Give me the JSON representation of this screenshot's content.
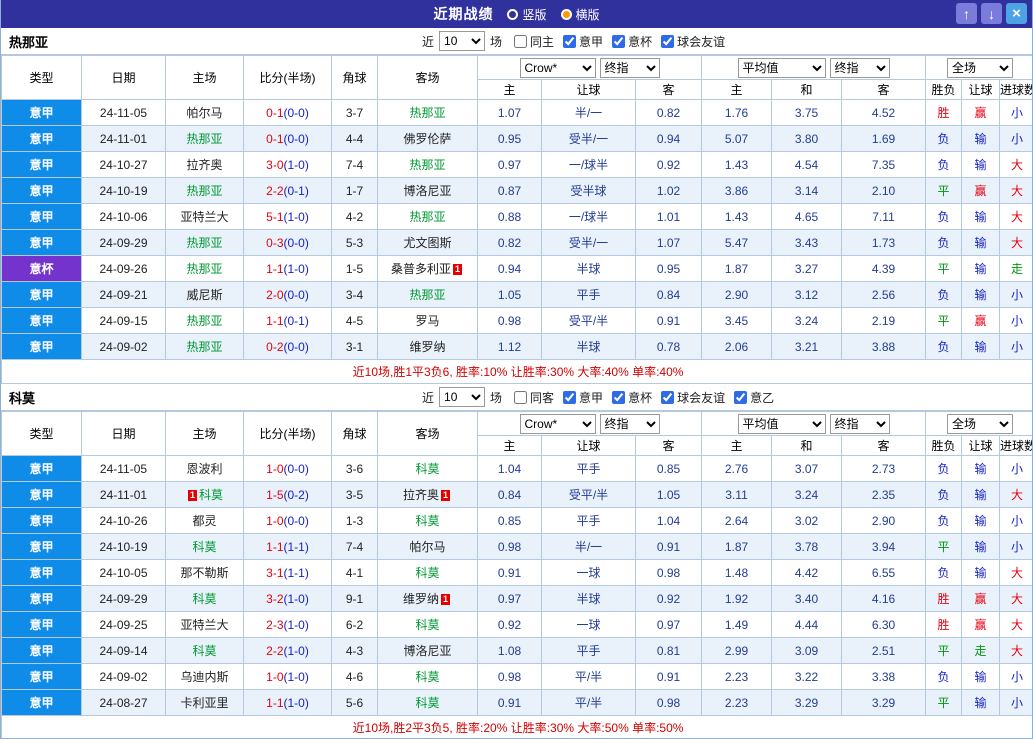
{
  "titlebar": {
    "title": "近期战绩",
    "radios": [
      {
        "label": "竖版",
        "selected": false
      },
      {
        "label": "横版",
        "selected": true
      }
    ],
    "up_glyph": "↑",
    "down_glyph": "↓",
    "close_glyph": "×"
  },
  "table_header": {
    "left_cols": [
      "类型",
      "日期",
      "主场",
      "比分(半场)",
      "角球",
      "客场"
    ],
    "group1": {
      "select1": "Crow*",
      "select2": "终指",
      "subcols": [
        "主",
        "让球",
        "客"
      ]
    },
    "group2": {
      "select1": "平均值",
      "select2": "终指",
      "subcols": [
        "主",
        "和",
        "客"
      ]
    },
    "group3": {
      "select1": "全场",
      "subcols": [
        "胜负",
        "让球",
        "进球数"
      ]
    }
  },
  "colors": {
    "titlebar_bg": "#31319e",
    "radio_selected": "#ff9900",
    "league": {
      "意甲": "#0f8ce8",
      "意杯": "#7433cc"
    },
    "results": {
      "胜": "#e60012",
      "赢": "#e60012",
      "大": "#e60012",
      "平": "#00930f",
      "走": "#00930f",
      "负": "#1522c8",
      "输": "#1522c8",
      "小": "#1522c8"
    },
    "score_full": "#e60012",
    "score_half": "#1522c8",
    "focus_team": "#009933",
    "odds_text": "#233c92",
    "summary_text": "#d40000"
  },
  "sections": [
    {
      "team": "热那亚",
      "filter": {
        "near_label": "近",
        "count": "10",
        "games_label": "场",
        "checkboxes": [
          {
            "label": "同主",
            "checked": false
          },
          {
            "label": "意甲",
            "checked": true
          },
          {
            "label": "意杯",
            "checked": true
          },
          {
            "label": "球会友谊",
            "checked": true
          }
        ]
      },
      "rows": [
        {
          "league": "意甲",
          "date": "24-11-05",
          "home": "帕尔马",
          "score": "0-1",
          "half": "(0-0)",
          "corner": "3-7",
          "away": "热那亚",
          "away_focus": true,
          "crow_home": "1.07",
          "crow_line": "半/一",
          "crow_away": "0.82",
          "avg_home": "1.76",
          "avg_draw": "3.75",
          "avg_away": "4.52",
          "wdl": "胜",
          "let_result": "赢",
          "goal_result": "小"
        },
        {
          "league": "意甲",
          "date": "24-11-01",
          "home": "热那亚",
          "home_focus": true,
          "score": "0-1",
          "half": "(0-0)",
          "corner": "4-4",
          "away": "佛罗伦萨",
          "crow_home": "0.95",
          "crow_line": "受半/一",
          "crow_away": "0.94",
          "avg_home": "5.07",
          "avg_draw": "3.80",
          "avg_away": "1.69",
          "wdl": "负",
          "let_result": "输",
          "goal_result": "小"
        },
        {
          "league": "意甲",
          "date": "24-10-27",
          "home": "拉齐奥",
          "score": "3-0",
          "half": "(1-0)",
          "corner": "7-4",
          "away": "热那亚",
          "away_focus": true,
          "crow_home": "0.97",
          "crow_line": "一/球半",
          "crow_away": "0.92",
          "avg_home": "1.43",
          "avg_draw": "4.54",
          "avg_away": "7.35",
          "wdl": "负",
          "let_result": "输",
          "goal_result": "大"
        },
        {
          "league": "意甲",
          "date": "24-10-19",
          "home": "热那亚",
          "home_focus": true,
          "score": "2-2",
          "half": "(0-1)",
          "corner": "1-7",
          "away": "博洛尼亚",
          "crow_home": "0.87",
          "crow_line": "受半球",
          "crow_away": "1.02",
          "avg_home": "3.86",
          "avg_draw": "3.14",
          "avg_away": "2.10",
          "wdl": "平",
          "let_result": "赢",
          "goal_result": "大"
        },
        {
          "league": "意甲",
          "date": "24-10-06",
          "home": "亚特兰大",
          "score": "5-1",
          "half": "(1-0)",
          "corner": "4-2",
          "away": "热那亚",
          "away_focus": true,
          "crow_home": "0.88",
          "crow_line": "一/球半",
          "crow_away": "1.01",
          "avg_home": "1.43",
          "avg_draw": "4.65",
          "avg_away": "7.11",
          "wdl": "负",
          "let_result": "输",
          "goal_result": "大"
        },
        {
          "league": "意甲",
          "date": "24-09-29",
          "home": "热那亚",
          "home_focus": true,
          "score": "0-3",
          "half": "(0-0)",
          "corner": "5-3",
          "away": "尤文图斯",
          "crow_home": "0.82",
          "crow_line": "受半/一",
          "crow_away": "1.07",
          "avg_home": "5.47",
          "avg_draw": "3.43",
          "avg_away": "1.73",
          "wdl": "负",
          "let_result": "输",
          "goal_result": "大"
        },
        {
          "league": "意杯",
          "date": "24-09-26",
          "home": "热那亚",
          "home_focus": true,
          "score": "1-1",
          "half": "(1-0)",
          "corner": "1-5",
          "away": "桑普多利亚",
          "away_card": "1",
          "crow_home": "0.94",
          "crow_line": "半球",
          "crow_away": "0.95",
          "avg_home": "1.87",
          "avg_draw": "3.27",
          "avg_away": "4.39",
          "wdl": "平",
          "let_result": "输",
          "goal_result": "走"
        },
        {
          "league": "意甲",
          "date": "24-09-21",
          "home": "威尼斯",
          "score": "2-0",
          "half": "(0-0)",
          "corner": "3-4",
          "away": "热那亚",
          "away_focus": true,
          "crow_home": "1.05",
          "crow_line": "平手",
          "crow_away": "0.84",
          "avg_home": "2.90",
          "avg_draw": "3.12",
          "avg_away": "2.56",
          "wdl": "负",
          "let_result": "输",
          "goal_result": "小"
        },
        {
          "league": "意甲",
          "date": "24-09-15",
          "home": "热那亚",
          "home_focus": true,
          "score": "1-1",
          "half": "(0-1)",
          "corner": "4-5",
          "away": "罗马",
          "crow_home": "0.98",
          "crow_line": "受平/半",
          "crow_away": "0.91",
          "avg_home": "3.45",
          "avg_draw": "3.24",
          "avg_away": "2.19",
          "wdl": "平",
          "let_result": "赢",
          "goal_result": "小"
        },
        {
          "league": "意甲",
          "date": "24-09-02",
          "home": "热那亚",
          "home_focus": true,
          "score": "0-2",
          "half": "(0-0)",
          "corner": "3-1",
          "away": "维罗纳",
          "crow_home": "1.12",
          "crow_line": "半球",
          "crow_away": "0.78",
          "avg_home": "2.06",
          "avg_draw": "3.21",
          "avg_away": "3.88",
          "wdl": "负",
          "let_result": "输",
          "goal_result": "小"
        }
      ],
      "summary": "近10场,胜1平3负6, 胜率:10% 让胜率:30% 大率:40% 单率:40%"
    },
    {
      "team": "科莫",
      "filter": {
        "near_label": "近",
        "count": "10",
        "games_label": "场",
        "checkboxes": [
          {
            "label": "同客",
            "checked": false
          },
          {
            "label": "意甲",
            "checked": true
          },
          {
            "label": "意杯",
            "checked": true
          },
          {
            "label": "球会友谊",
            "checked": true
          },
          {
            "label": "意乙",
            "checked": true
          }
        ]
      },
      "rows": [
        {
          "league": "意甲",
          "date": "24-11-05",
          "home": "恩波利",
          "score": "1-0",
          "half": "(0-0)",
          "corner": "3-6",
          "away": "科莫",
          "away_focus": true,
          "crow_home": "1.04",
          "crow_line": "平手",
          "crow_away": "0.85",
          "avg_home": "2.76",
          "avg_draw": "3.07",
          "avg_away": "2.73",
          "wdl": "负",
          "let_result": "输",
          "goal_result": "小"
        },
        {
          "league": "意甲",
          "date": "24-11-01",
          "home": "科莫",
          "home_focus": true,
          "home_card": "1",
          "home_card_before": true,
          "score": "1-5",
          "half": "(0-2)",
          "corner": "3-5",
          "away": "拉齐奥",
          "away_card": "1",
          "crow_home": "0.84",
          "crow_line": "受平/半",
          "crow_away": "1.05",
          "avg_home": "3.11",
          "avg_draw": "3.24",
          "avg_away": "2.35",
          "wdl": "负",
          "let_result": "输",
          "goal_result": "大"
        },
        {
          "league": "意甲",
          "date": "24-10-26",
          "home": "都灵",
          "score": "1-0",
          "half": "(0-0)",
          "corner": "1-3",
          "away": "科莫",
          "away_focus": true,
          "crow_home": "0.85",
          "crow_line": "平手",
          "crow_away": "1.04",
          "avg_home": "2.64",
          "avg_draw": "3.02",
          "avg_away": "2.90",
          "wdl": "负",
          "let_result": "输",
          "goal_result": "小"
        },
        {
          "league": "意甲",
          "date": "24-10-19",
          "home": "科莫",
          "home_focus": true,
          "score": "1-1",
          "half": "(1-1)",
          "corner": "7-4",
          "away": "帕尔马",
          "crow_home": "0.98",
          "crow_line": "半/一",
          "crow_away": "0.91",
          "avg_home": "1.87",
          "avg_draw": "3.78",
          "avg_away": "3.94",
          "wdl": "平",
          "let_result": "输",
          "goal_result": "小"
        },
        {
          "league": "意甲",
          "date": "24-10-05",
          "home": "那不勒斯",
          "score": "3-1",
          "half": "(1-1)",
          "corner": "4-1",
          "away": "科莫",
          "away_focus": true,
          "crow_home": "0.91",
          "crow_line": "一球",
          "crow_away": "0.98",
          "avg_home": "1.48",
          "avg_draw": "4.42",
          "avg_away": "6.55",
          "wdl": "负",
          "let_result": "输",
          "goal_result": "大"
        },
        {
          "league": "意甲",
          "date": "24-09-29",
          "home": "科莫",
          "home_focus": true,
          "score": "3-2",
          "half": "(1-0)",
          "corner": "9-1",
          "away": "维罗纳",
          "away_card": "1",
          "crow_home": "0.97",
          "crow_line": "半球",
          "crow_away": "0.92",
          "avg_home": "1.92",
          "avg_draw": "3.40",
          "avg_away": "4.16",
          "wdl": "胜",
          "let_result": "赢",
          "goal_result": "大"
        },
        {
          "league": "意甲",
          "date": "24-09-25",
          "home": "亚特兰大",
          "score": "2-3",
          "half": "(1-0)",
          "corner": "6-2",
          "away": "科莫",
          "away_focus": true,
          "crow_home": "0.92",
          "crow_line": "一球",
          "crow_away": "0.97",
          "avg_home": "1.49",
          "avg_draw": "4.44",
          "avg_away": "6.30",
          "wdl": "胜",
          "let_result": "赢",
          "goal_result": "大"
        },
        {
          "league": "意甲",
          "date": "24-09-14",
          "home": "科莫",
          "home_focus": true,
          "score": "2-2",
          "half": "(1-0)",
          "corner": "4-3",
          "away": "博洛尼亚",
          "crow_home": "1.08",
          "crow_line": "平手",
          "crow_away": "0.81",
          "avg_home": "2.99",
          "avg_draw": "3.09",
          "avg_away": "2.51",
          "wdl": "平",
          "let_result": "走",
          "goal_result": "大"
        },
        {
          "league": "意甲",
          "date": "24-09-02",
          "home": "乌迪内斯",
          "score": "1-0",
          "half": "(1-0)",
          "corner": "4-6",
          "away": "科莫",
          "away_focus": true,
          "crow_home": "0.98",
          "crow_line": "平/半",
          "crow_away": "0.91",
          "avg_home": "2.23",
          "avg_draw": "3.22",
          "avg_away": "3.38",
          "wdl": "负",
          "let_result": "输",
          "goal_result": "小"
        },
        {
          "league": "意甲",
          "date": "24-08-27",
          "home": "卡利亚里",
          "score": "1-1",
          "half": "(1-0)",
          "corner": "5-6",
          "away": "科莫",
          "away_focus": true,
          "crow_home": "0.91",
          "crow_line": "平/半",
          "crow_away": "0.98",
          "avg_home": "2.23",
          "avg_draw": "3.29",
          "avg_away": "3.29",
          "wdl": "平",
          "let_result": "输",
          "goal_result": "小"
        }
      ],
      "summary": "近10场,胜2平3负5, 胜率:20% 让胜率:30% 大率:50% 单率:50%"
    }
  ]
}
